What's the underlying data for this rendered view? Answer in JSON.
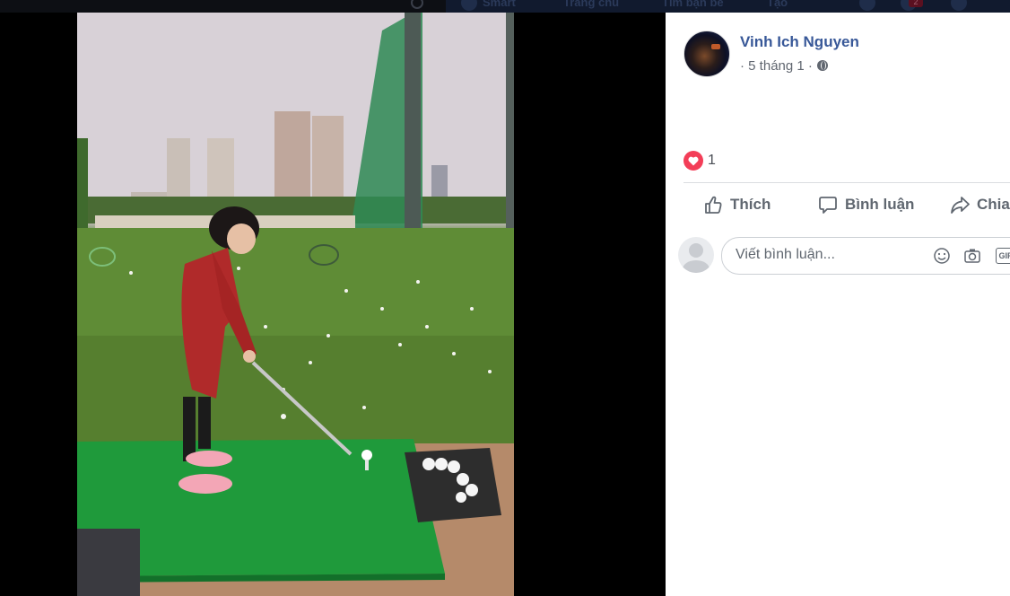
{
  "topbar": {
    "nav_items": [
      "Smart",
      "Trang chủ",
      "Tìm bạn bè",
      "Tạo"
    ],
    "notification_count": "2"
  },
  "photo": {
    "alt": "girl-golf-practice-photo"
  },
  "post": {
    "author": "Vinh Ich Nguyen",
    "timestamp": "5 tháng 1",
    "separator_before": "·",
    "separator_after": "·",
    "privacy_icon": "globe-icon",
    "reaction_icon": "heart-icon",
    "reaction_count": "1",
    "colors": {
      "author": "#385898",
      "reaction": "#f33e58",
      "action_text": "#606770"
    }
  },
  "actions": {
    "like_label": "Thích",
    "comment_label": "Bình luận",
    "share_label": "Chia"
  },
  "comment": {
    "placeholder": "Viết bình luận...",
    "icons": [
      "emoji-icon",
      "camera-icon",
      "gif-icon"
    ],
    "gif_label": "GIF"
  }
}
